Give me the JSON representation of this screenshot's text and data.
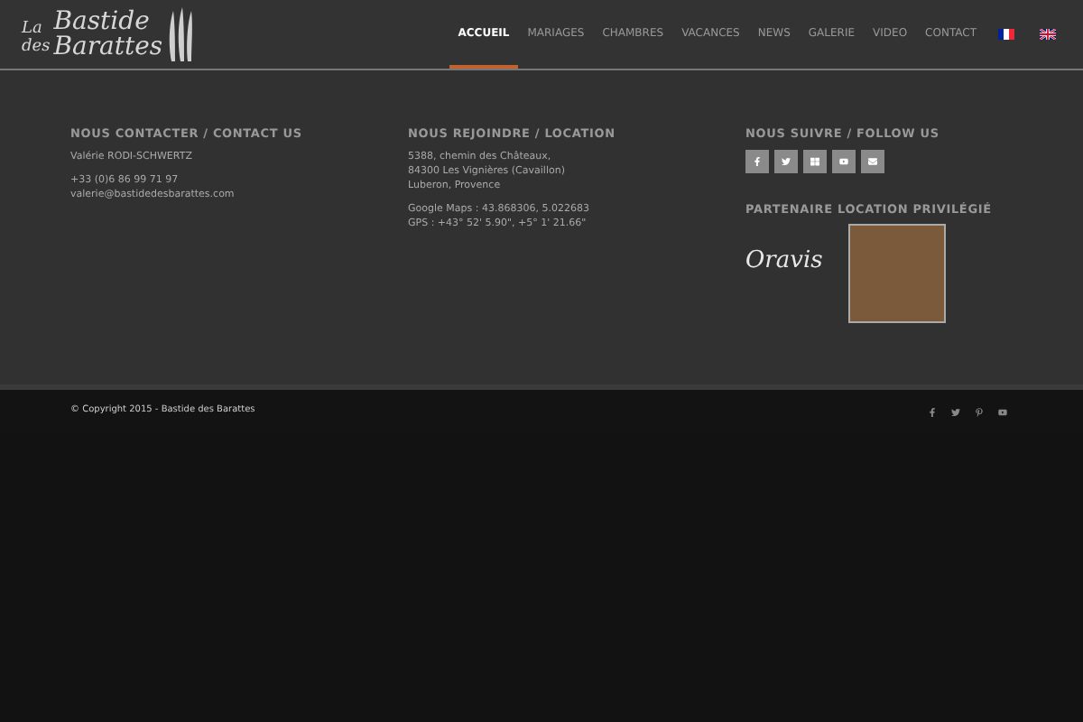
{
  "logo": {
    "line1": "La",
    "line2": "des",
    "word1": "Bastide",
    "word2": "Barattes"
  },
  "nav": [
    {
      "label": "ACCUEIL",
      "selected": true
    },
    {
      "label": "MARIAGES",
      "selected": false
    },
    {
      "label": "CHAMBRES",
      "selected": false
    },
    {
      "label": "VACANCES",
      "selected": false
    },
    {
      "label": "NEWS",
      "selected": false
    },
    {
      "label": "GALERIE",
      "selected": false
    },
    {
      "label": "VIDEO",
      "selected": false
    },
    {
      "label": "CONTACT",
      "selected": false
    }
  ],
  "languages": [
    {
      "kind": "fr"
    },
    {
      "kind": "en"
    }
  ],
  "contact": {
    "title": "NOUS CONTACTER / CONTACT US",
    "name": "Valérie RODI-SCHWERTZ",
    "phone": "+33 (0)6 86 99 71 97",
    "email": "valerie@bastidedesbarattes.com"
  },
  "location": {
    "title": "NOUS REJOINDRE / LOCATION",
    "address": [
      "5388, chemin des Châteaux,",
      "84300 Les Vignières (Cavaillon)",
      "Luberon, Provence"
    ],
    "coords": [
      "Google Maps : 43.868306, 5.022683",
      "GPS : +43° 52' 5.90\", +5° 1' 21.66\""
    ]
  },
  "follow": {
    "title": "NOUS SUIVRE / FOLLOW US",
    "icons": [
      {
        "kind": "facebook"
      },
      {
        "kind": "twitter"
      },
      {
        "kind": "grid"
      },
      {
        "kind": "youtube"
      },
      {
        "kind": "mail"
      }
    ]
  },
  "partner": {
    "title": "PARTENAIRE LOCATION PRIVILÉGIÉ",
    "logo_text": "Oravis"
  },
  "socket": {
    "copyright": "© Copyright 2015 - Bastide des Barattes",
    "icons": [
      {
        "kind": "facebook"
      },
      {
        "kind": "twitter"
      },
      {
        "kind": "pinterest"
      },
      {
        "kind": "youtube"
      }
    ]
  }
}
